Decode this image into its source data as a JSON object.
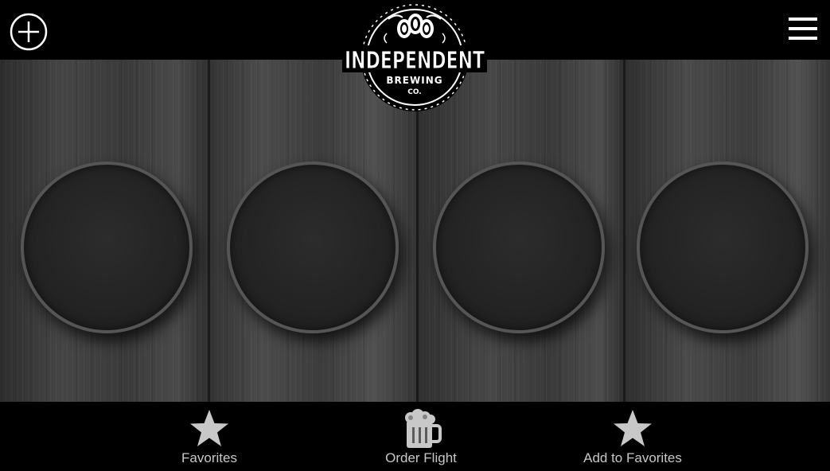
{
  "header": {
    "add_icon": "plus-circle-icon",
    "menu_icon": "hamburger-menu-icon",
    "logo": {
      "name": "INDEPENDENT",
      "line2": "BREWING",
      "line3": "CO."
    }
  },
  "flight": {
    "slots": [
      {
        "id": 1,
        "state": "empty"
      },
      {
        "id": 2,
        "state": "empty"
      },
      {
        "id": 3,
        "state": "empty"
      },
      {
        "id": 4,
        "state": "empty"
      }
    ]
  },
  "bottom_nav": {
    "items": [
      {
        "label": "Favorites",
        "icon": "star-icon"
      },
      {
        "label": "Order Flight",
        "icon": "beer-mug-icon"
      },
      {
        "label": "Add to Favorites",
        "icon": "star-icon"
      }
    ]
  },
  "colors": {
    "background": "#000000",
    "icon_fill": "#c8c8c8",
    "slot_border": "#555555"
  }
}
